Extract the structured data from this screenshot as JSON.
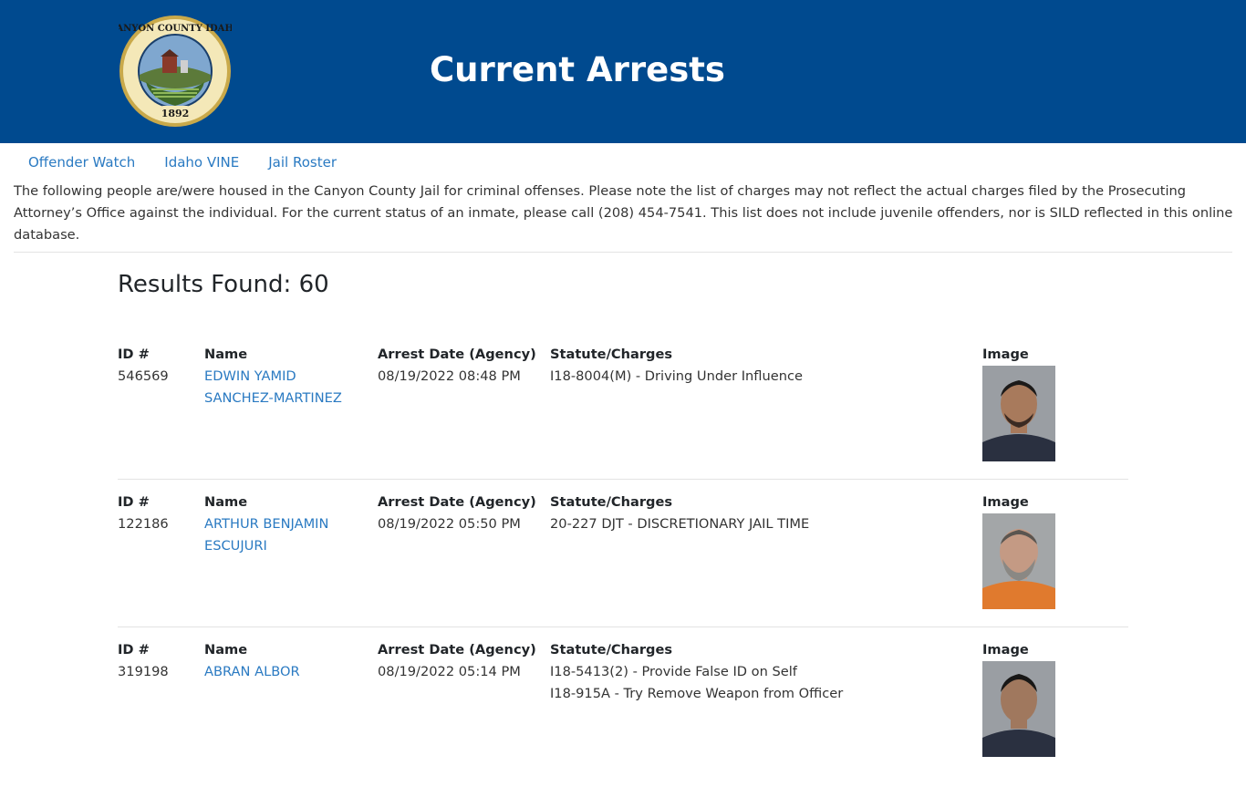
{
  "header": {
    "title": "Current Arrests",
    "seal": {
      "name": "Canyon County Idaho seal",
      "text_top": "CANYON COUNTY IDAHO",
      "year": "1892",
      "colors": {
        "ring": "#f4e8b8",
        "gold": "#c9a94a",
        "band": "#1a3f6b"
      }
    },
    "background": "#004a8f"
  },
  "nav": {
    "links": [
      "Offender Watch",
      "Idaho VINE",
      "Jail Roster"
    ]
  },
  "intro": {
    "text": "The following people are/were housed in the Canyon County Jail for criminal offenses. Please note the list of charges may not reflect the actual charges filed by the Prosecuting Attorney’s Office against the individual. For the current status of an inmate, please call (208) 454-7541. This list does not include juvenile offenders, nor is SILD reflected in this online database."
  },
  "results": {
    "title": "Results Found: 60"
  },
  "labels": {
    "id": "ID #",
    "name": "Name",
    "arrest_date": "Arrest Date (Agency)",
    "charges": "Statute/Charges",
    "image": "Image"
  },
  "records": [
    {
      "id": "546569",
      "name_line1": "EDWIN YAMID",
      "name_line2": "SANCHEZ-MARTINEZ",
      "arrest_date": "08/19/2022 08:48 PM",
      "charges": [
        "I18-8004(M) - Driving Under Influence"
      ],
      "mug": {
        "shirt": "#2a3040",
        "skin": "#a87a5c",
        "hair": "#1c1a19",
        "bg": "#9a9ea3"
      }
    },
    {
      "id": "122186",
      "name_line1": "ARTHUR BENJAMIN",
      "name_line2": "ESCUJURI",
      "arrest_date": "08/19/2022 05:50 PM",
      "charges": [
        "20-227 DJT - DISCRETIONARY JAIL TIME"
      ],
      "mug": {
        "shirt": "#e07a2e",
        "skin": "#c49a84",
        "hair": "#5a5550",
        "bg": "#a3a6a8"
      }
    },
    {
      "id": "319198",
      "name_line1": "ABRAN ALBOR",
      "name_line2": "",
      "arrest_date": "08/19/2022 05:14 PM",
      "charges": [
        "I18-5413(2) - Provide False ID on Self",
        "I18-915A - Try Remove Weapon from Officer"
      ],
      "mug": {
        "shirt": "#2a3040",
        "skin": "#a0785e",
        "hair": "#181716",
        "bg": "#9a9ea3"
      }
    }
  ]
}
